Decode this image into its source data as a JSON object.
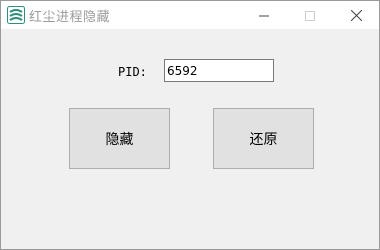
{
  "window": {
    "title": "红尘进程隐藏",
    "icon": "app-logo-icon",
    "controls": [
      "minimize-icon",
      "maximize-icon",
      "close-icon"
    ]
  },
  "form": {
    "pid_label": "PID:",
    "pid_value": "6592"
  },
  "buttons": {
    "hide_label": "隐藏",
    "restore_label": "还原"
  },
  "colors": {
    "client_bg": "#f0f0f0",
    "button_bg": "#e1e1e1",
    "button_border": "#adadad",
    "icon_accent": "#2f8f78"
  }
}
